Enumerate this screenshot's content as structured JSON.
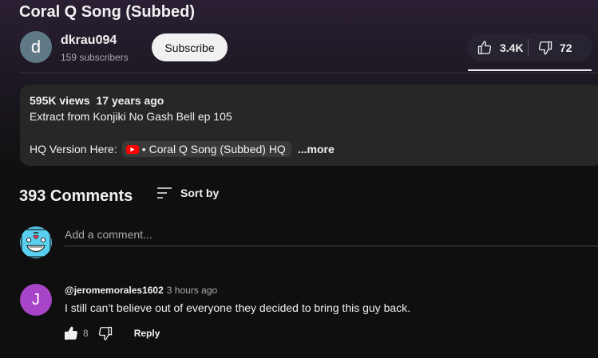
{
  "video": {
    "title": "Coral Q Song (Subbed)"
  },
  "channel": {
    "avatar_letter": "d",
    "name": "dkrau094",
    "subscribers": "159 subscribers",
    "subscribe_label": "Subscribe"
  },
  "actions": {
    "likes": "3.4K",
    "dislikes": "72",
    "like_icon": "thumbs-up-icon",
    "dislike_icon": "thumbs-down-icon"
  },
  "description": {
    "views": "595K views",
    "age": "17 years ago",
    "line1": "Extract from Konjiki No Gash Bell ep 105",
    "hq_prefix": "HQ Version Here:",
    "link_dot": "•",
    "link_text": "Coral Q Song (Subbed) HQ",
    "more_label": "...more"
  },
  "comments": {
    "count_label": "393 Comments",
    "sort_label": "Sort by",
    "add_placeholder": "Add a comment...",
    "items": [
      {
        "avatar_letter": "J",
        "author": "@jeromemorales1602",
        "time": "3 hours ago",
        "text": "I still can't believe out of everyone they decided to bring this guy back.",
        "likes": "8",
        "reply_label": "Reply"
      }
    ]
  },
  "colors": {
    "background": "#0f0f0f",
    "accent_red": "#ff0000",
    "commenter_avatar": "#a844c8",
    "channel_avatar": "#5f7a86"
  }
}
